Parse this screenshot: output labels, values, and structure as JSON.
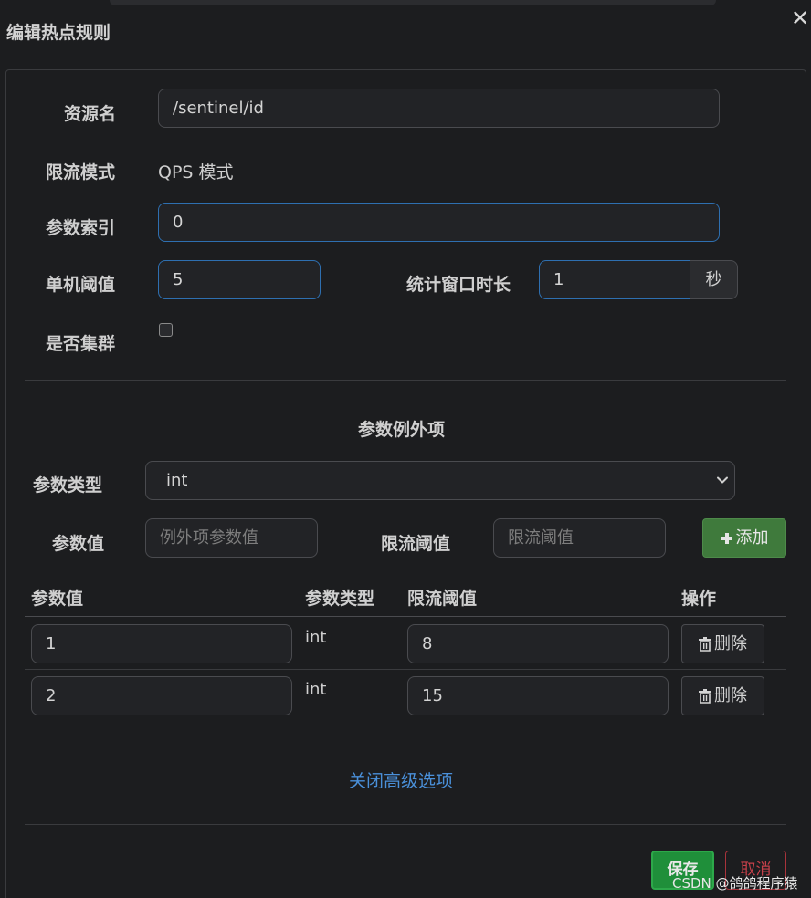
{
  "dialog": {
    "title": "编辑热点规则",
    "close_glyph": "✕"
  },
  "form": {
    "resource_label": "资源名",
    "resource_value": "/sentinel/id",
    "mode_label": "限流模式",
    "mode_value": "QPS 模式",
    "param_index_label": "参数索引",
    "param_index_value": "0",
    "threshold_label": "单机阈值",
    "threshold_value": "5",
    "window_label": "统计窗口时长",
    "window_value": "1",
    "window_unit": "秒",
    "cluster_label": "是否集群",
    "cluster_checked": false
  },
  "exceptions": {
    "section_title": "参数例外项",
    "type_label": "参数类型",
    "type_selected": "int",
    "value_label": "参数值",
    "value_placeholder": "例外项参数值",
    "limit_label": "限流阈值",
    "limit_placeholder": "限流阈值",
    "add_button": "添加",
    "add_icon": "plus-icon",
    "table": {
      "headers": [
        "参数值",
        "参数类型",
        "限流阈值",
        "操作"
      ],
      "rows": [
        {
          "value": "1",
          "type": "int",
          "limit": "8",
          "action": "删除"
        },
        {
          "value": "2",
          "type": "int",
          "limit": "15",
          "action": "删除"
        }
      ],
      "delete_icon": "trash-icon"
    }
  },
  "advanced_toggle": "关闭高级选项",
  "footer": {
    "save": "保存",
    "cancel": "取消"
  },
  "watermark": "CSDN @鸽鸽程序猿",
  "colors": {
    "background": "#1c1d1f",
    "link": "#4a90d9",
    "save": "#1f8f3a",
    "add": "#3f7a3c",
    "cancel": "#c6404a"
  }
}
